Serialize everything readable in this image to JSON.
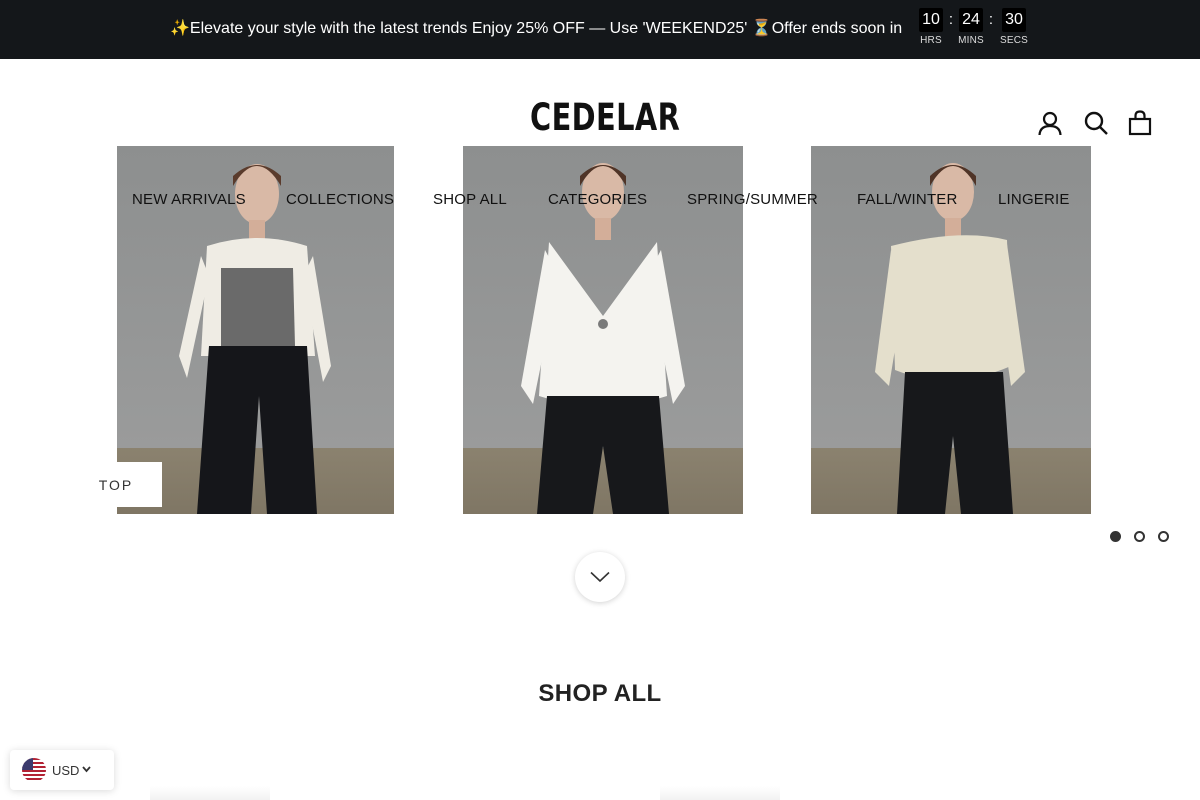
{
  "announcement": {
    "text": "✨Elevate your style with the latest trends Enjoy 25% OFF — Use 'WEEKEND25' ⏳Offer ends soon in",
    "countdown": [
      {
        "value": "10",
        "label": "HRS"
      },
      {
        "value": "24",
        "label": "MINS"
      },
      {
        "value": "30",
        "label": "SECS"
      }
    ],
    "separator": ":"
  },
  "header": {
    "logo": "CEDELAR",
    "icons": [
      "account-icon",
      "search-icon",
      "cart-icon"
    ]
  },
  "nav": {
    "items": [
      "NEW ARRIVALS",
      "COLLECTIONS",
      "SHOP ALL",
      "CATEGORIES",
      "SPRING/SUMMER",
      "FALL/WINTER",
      "LINGERIE"
    ]
  },
  "slideshow": {
    "slides": [
      "model-grey-white-top",
      "model-white-wrap-blouse",
      "model-cream-off-shoulder-blouse"
    ],
    "dots_count": 3,
    "active_dot": 0
  },
  "top_button": "TOP",
  "section": {
    "title": "SHOP ALL"
  },
  "currency": {
    "code": "USD"
  },
  "colors": {
    "announce_bg": "#14171a",
    "text": "#1c1c1c",
    "accent": "#333333"
  }
}
